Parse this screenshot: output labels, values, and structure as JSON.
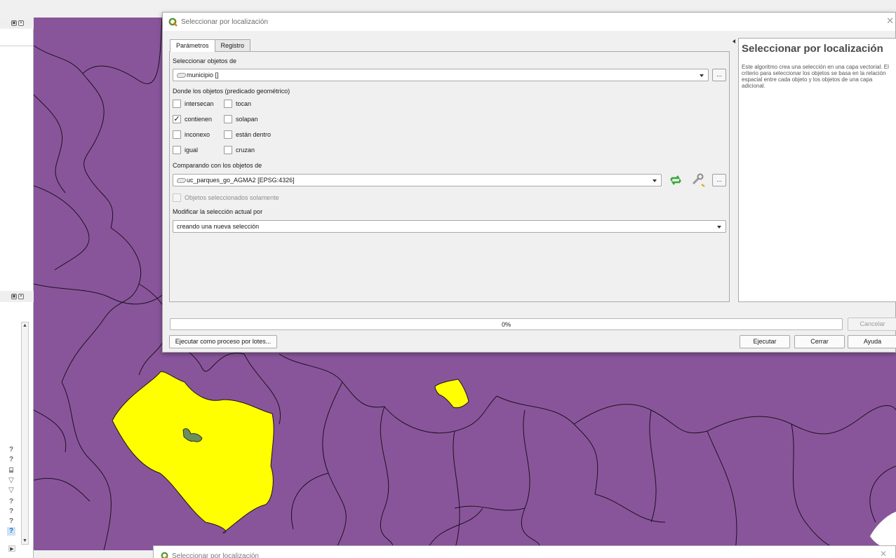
{
  "dialog": {
    "title": "Seleccionar por localización",
    "close_icon": "close-icon",
    "tabs": [
      {
        "label": "Parámetros",
        "active": true
      },
      {
        "label": "Registro",
        "active": false
      }
    ],
    "select_from_label": "Seleccionar objetos de",
    "select_from_value": "municipio []",
    "predicate_label": "Donde los objetos (predicado geométrico)",
    "predicates": [
      {
        "label": "intersecan",
        "checked": false
      },
      {
        "label": "tocan",
        "checked": false
      },
      {
        "label": "contienen",
        "checked": true
      },
      {
        "label": "solapan",
        "checked": false
      },
      {
        "label": "inconexo",
        "checked": false
      },
      {
        "label": "están dentro",
        "checked": false
      },
      {
        "label": "igual",
        "checked": false
      },
      {
        "label": "cruzan",
        "checked": false
      }
    ],
    "compare_label": "Comparando con los objetos de",
    "compare_value": "uc_parques_go_AGMA2 [EPSG:4326]",
    "selected_only_label": "Objetos seleccionados solamente",
    "modify_label": "Modificar la selección actual por",
    "modify_value": "creando una nueva selección",
    "dots": "...",
    "help": {
      "title": "Seleccionar por localización",
      "text": "Este algoritmo crea una selección en una capa vectorial. El criterio para seleccionar los objetos se basa en la relación espacial entre cada objeto y los objetos de una capa adicional."
    },
    "progress": {
      "text": "0%",
      "value": 0
    },
    "buttons": {
      "cancel": "Cancelar",
      "batch": "Ejecutar como proceso por lotes...",
      "run": "Ejecutar",
      "close": "Cerrar",
      "help": "Ayuda"
    }
  },
  "dialog2": {
    "title": "Seleccionar por localización"
  },
  "colors": {
    "map_fill": "#88559a",
    "selected_fill": "#ffff00",
    "park_fill": "#6a8f5c",
    "accent": "#3c8fd8"
  },
  "side_icons": [
    "help-icon",
    "help-icon",
    "layers-icon",
    "filter-icon",
    "filter-icon",
    "help-icon",
    "help-icon",
    "help-icon",
    "help-icon"
  ]
}
